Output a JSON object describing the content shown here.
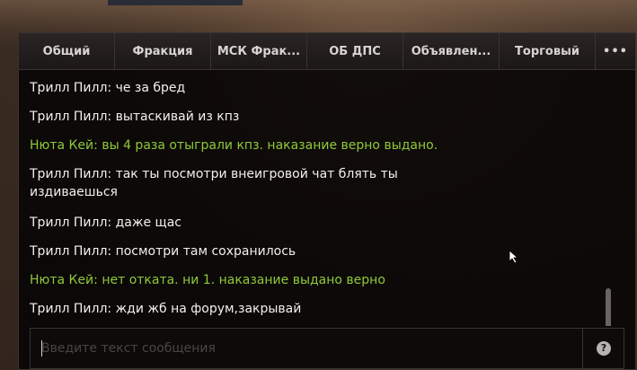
{
  "tabs": [
    {
      "label": "Общий"
    },
    {
      "label": "Фракция"
    },
    {
      "label": "МСК Фрак..."
    },
    {
      "label": "ОБ ДПС"
    },
    {
      "label": "Объявлен..."
    },
    {
      "label": "Торговый"
    }
  ],
  "more_tabs_label": "•••",
  "messages": [
    {
      "text": "Трилл Пилл: че за бред",
      "color": "#f2f0ee"
    },
    {
      "text": "Трилл Пилл: вытаскивай из кпз",
      "color": "#f2f0ee"
    },
    {
      "text": "Нюта Кей: вы 4 раза отыграли кпз. наказание верно выдано.",
      "color": "#8fc93a"
    },
    {
      "text": "Трилл Пилл: так ты посмотри внеигровой чат блять ты издиваешься",
      "color": "#f2f0ee"
    },
    {
      "text": "Трилл Пилл: даже щас",
      "color": "#f2f0ee"
    },
    {
      "text": "Трилл Пилл: посмотри там сохранилось",
      "color": "#f2f0ee"
    },
    {
      "text": "Нюта Кей: нет отката. ни 1. наказание выдано верно",
      "color": "#8fc93a"
    },
    {
      "text": "Трилл Пилл: жди жб на форум,закрывай",
      "color": "#f2f0ee"
    }
  ],
  "input": {
    "placeholder": "Введите текст сообщения",
    "value": ""
  },
  "help_label": "?",
  "icons": {
    "help": "question-circle-icon",
    "more": "ellipsis-icon",
    "cursor": "mouse-pointer-icon"
  }
}
